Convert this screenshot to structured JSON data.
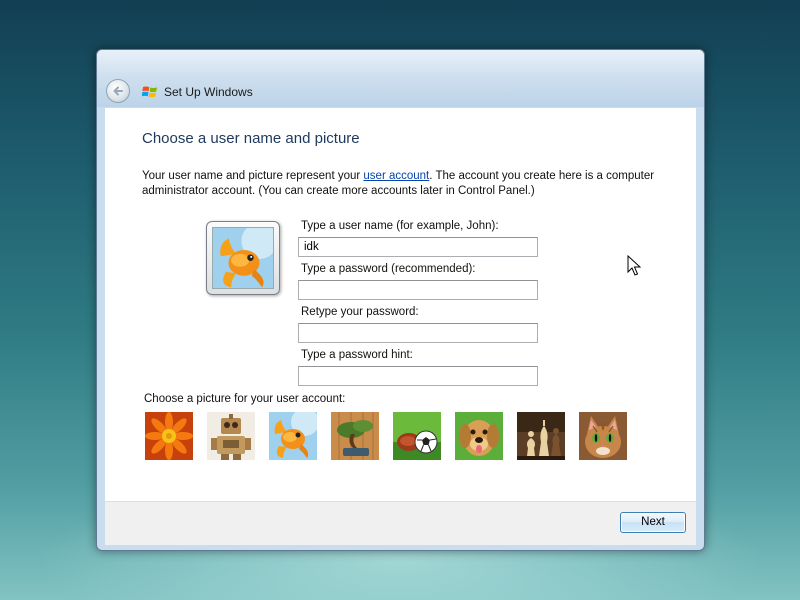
{
  "window": {
    "title": "Set Up Windows"
  },
  "page": {
    "heading": "Choose a user name and picture",
    "description_part1": "Your user name and picture represent your ",
    "description_link": "user account",
    "description_part2": ". The account you create here is a computer administrator account. (You can create more accounts later in Control Panel.)"
  },
  "form": {
    "username_label": "Type a user name (for example, John):",
    "username_value": "idk",
    "password_label": "Type a password (recommended):",
    "password_value": "",
    "retype_label": "Retype your password:",
    "retype_value": "",
    "hint_label": "Type a password hint:",
    "hint_value": ""
  },
  "pictures": {
    "label": "Choose a picture for your user account:",
    "items": [
      "flower",
      "robot",
      "goldfish",
      "bonsai",
      "soccer-ball",
      "dog",
      "chess",
      "kitten"
    ],
    "selected": "goldfish"
  },
  "footer": {
    "next_label": "Next"
  },
  "icons": {
    "back": "back-arrow-icon",
    "windows_logo": "windows-logo-icon"
  },
  "colors": {
    "heading": "#1e395b",
    "link": "#0645ad",
    "titlebar": "#cfe0ef",
    "button_border": "#3c7fb1"
  }
}
